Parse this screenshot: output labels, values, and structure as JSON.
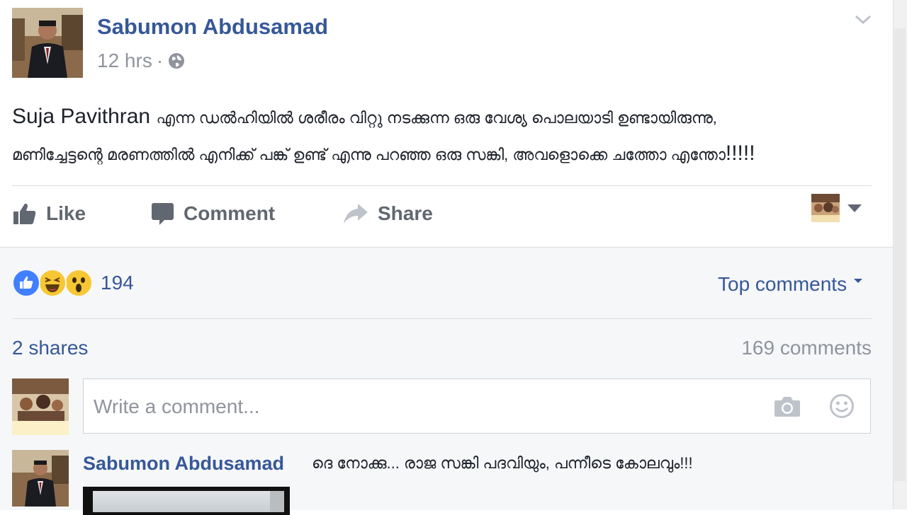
{
  "post": {
    "author": "Sabumon Abdusamad",
    "time": "12 hrs",
    "separator": "·",
    "audience_icon": "globe-icon",
    "text_en": "Suja Pavithran",
    "text_line1": "എന്ന ഡൽഹിയിൽ ശരീരം വിറ്റു നടക്കുന്ന ഒരു വേശ്യ പൊലയാടി ഉണ്ടായിരുന്നു,",
    "text_line2": "മണിച്ചേട്ടന്റെ മരണത്തിൽ എനിക്ക് പങ്ക് ഉണ്ട് എന്നു പറഞ്ഞ ഒരു സങ്കി, അവളൊക്കെ ചത്തോ എന്തോ",
    "text_line2_end": "!!!!!"
  },
  "actions": {
    "like": "Like",
    "comment": "Comment",
    "share": "Share"
  },
  "stats": {
    "reaction_count": "194",
    "reactions": [
      "like",
      "haha",
      "wow"
    ],
    "sort_label": "Top comments",
    "shares": "2 shares",
    "comments": "169 comments"
  },
  "composer": {
    "placeholder": "Write a comment..."
  },
  "first_comment": {
    "author": "Sabumon Abdusamad",
    "text": "ദെ നോക്കു... രാജ സങ്കി പദവിയും, പന്നീടെ കോലവും!!!"
  },
  "colors": {
    "link": "#365899",
    "muted": "#90949c",
    "action": "#606770",
    "like_blue": "#4080ff",
    "emoji_yellow": "#f7c733"
  }
}
